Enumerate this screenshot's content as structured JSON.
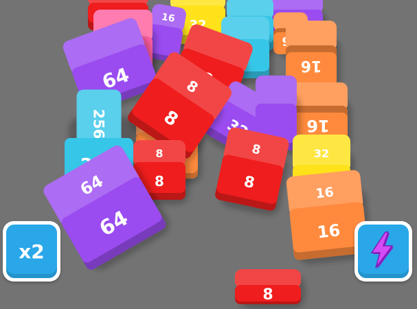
{
  "colors": {
    "floor": "#737373",
    "red": "#ef1d1d",
    "orange": "#ff8a3d",
    "purple": "#9a4cf0",
    "cyan": "#36c6e8",
    "yellow": "#ffe21a",
    "pink": "#ff5fa0",
    "button_bg": "#29a7e8",
    "button_border": "#ffffff",
    "lightning": "#c63cf0"
  },
  "cubes": [
    {
      "id": "c01",
      "color": "purple",
      "value": "",
      "top_value": ""
    },
    {
      "id": "c02",
      "color": "yellow",
      "value": "32",
      "top_value": ""
    },
    {
      "id": "c03",
      "color": "red",
      "value": "",
      "top_value": ""
    },
    {
      "id": "c04",
      "color": "cyan",
      "value": "",
      "top_value": ""
    },
    {
      "id": "c05",
      "color": "orange",
      "value": "16",
      "top_value": ""
    },
    {
      "id": "c06",
      "color": "purple",
      "value": "",
      "top_value": "16"
    },
    {
      "id": "c07",
      "color": "pink",
      "value": "",
      "top_value": ""
    },
    {
      "id": "c08",
      "color": "orange",
      "value": "16",
      "top_value": ""
    },
    {
      "id": "c09",
      "color": "cyan",
      "value": "",
      "top_value": ""
    },
    {
      "id": "c10",
      "color": "orange",
      "value": "16",
      "top_value": ""
    },
    {
      "id": "c11",
      "color": "red",
      "value": "8",
      "top_value": ""
    },
    {
      "id": "c12",
      "color": "purple",
      "value": "64",
      "top_value": ""
    },
    {
      "id": "c13",
      "color": "purple",
      "value": "32",
      "top_value": ""
    },
    {
      "id": "c14",
      "color": "purple",
      "value": "",
      "top_value": ""
    },
    {
      "id": "c15",
      "color": "orange",
      "value": "16",
      "top_value": ""
    },
    {
      "id": "c16",
      "color": "cyan",
      "value": "256",
      "top_value": "256"
    },
    {
      "id": "c17",
      "color": "red",
      "value": "8",
      "top_value": "8"
    },
    {
      "id": "c18",
      "color": "red",
      "value": "8",
      "top_value": "8"
    },
    {
      "id": "c19",
      "color": "red",
      "value": "8",
      "top_value": "8"
    },
    {
      "id": "c20",
      "color": "yellow",
      "value": "32",
      "top_value": "32"
    },
    {
      "id": "c21",
      "color": "orange",
      "value": "16",
      "top_value": "16"
    },
    {
      "id": "c22",
      "color": "purple",
      "value": "64",
      "top_value": "64"
    },
    {
      "id": "c23",
      "color": "red",
      "value": "8",
      "top_value": ""
    }
  ],
  "hud": {
    "multiplier_label": "x2",
    "powerup_icon": "lightning-icon"
  }
}
